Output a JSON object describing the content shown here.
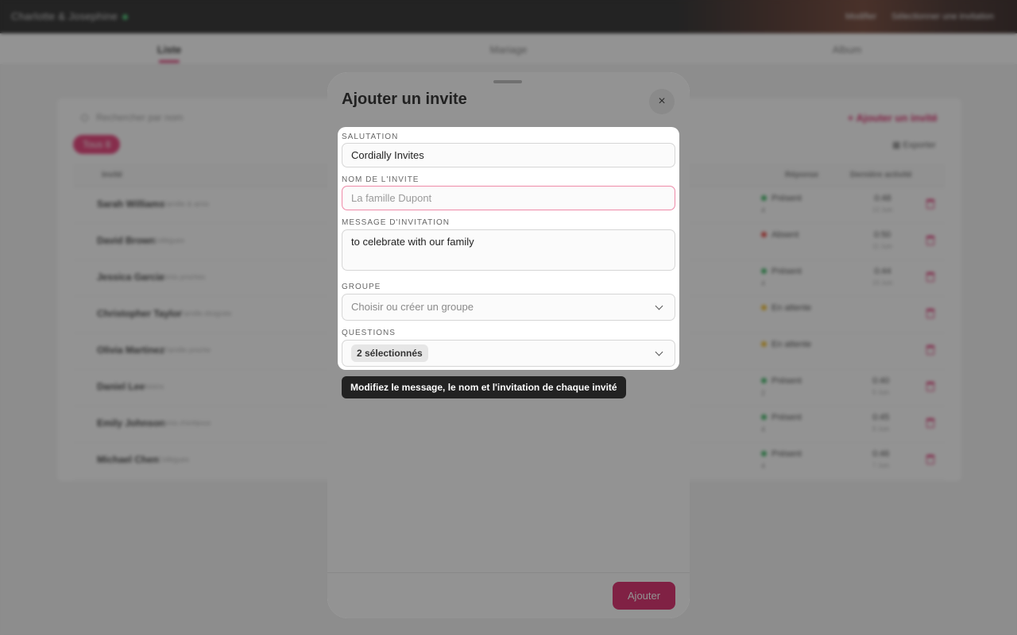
{
  "app": {
    "brand": "Charlotte & Josephine",
    "top_links": [
      "Modifier",
      "Sélectionner une invitation"
    ]
  },
  "tabs": [
    "Liste",
    "Mariage",
    "Album"
  ],
  "list": {
    "search_placeholder": "Rechercher par nom",
    "add_guest_label": "Ajouter un invité",
    "filter_chip": "Tous 8",
    "export_label": "Exporter",
    "columns": {
      "guest": "Invité",
      "response": "Réponse",
      "last_activity": "Dernière activité"
    },
    "rows": [
      {
        "name": "Sarah Williams",
        "sub": "Famille & amis",
        "status": "Présent",
        "count": "4",
        "time": "0:48",
        "date": "12 Juin"
      },
      {
        "name": "David Brown",
        "sub": "Collègues",
        "status": "Absent",
        "count": "",
        "time": "0:50",
        "date": "11 Juin"
      },
      {
        "name": "Jessica Garcia",
        "sub": "Amis proches",
        "status": "Présent",
        "count": "4",
        "time": "0:44",
        "date": "10 Juin"
      },
      {
        "name": "Christopher Taylor",
        "sub": "Famille éloignée",
        "status": "En attente",
        "count": "",
        "time": "",
        "date": ""
      },
      {
        "name": "Olivia Martinez",
        "sub": "Famille proche",
        "status": "En attente",
        "count": "",
        "time": "",
        "date": ""
      },
      {
        "name": "Daniel Lee",
        "sub": "Voisins",
        "status": "Présent",
        "count": "2",
        "time": "0:40",
        "date": "9 Juin"
      },
      {
        "name": "Emily Johnson",
        "sub": "Amis d'enfance",
        "status": "Présent",
        "count": "4",
        "time": "0:45",
        "date": "8 Juin"
      },
      {
        "name": "Michael Chen",
        "sub": "Collègues",
        "status": "Présent",
        "count": "4",
        "time": "0:46",
        "date": "7 Juin"
      }
    ]
  },
  "modal": {
    "title": "Ajouter un invite",
    "close_glyph": "×",
    "salutation_label": "SALUTATION",
    "salutation_value": "Cordially Invites",
    "name_label": "NOM DE L'INVITE",
    "name_placeholder": "La famille Dupont",
    "message_label": "MESSAGE D'INVITATION",
    "message_value": "to celebrate with our family",
    "group_label": "GROUPE",
    "group_placeholder": "Choisir ou créer un groupe",
    "questions_label": "QUESTIONS",
    "questions_value": "2 sélectionnés",
    "tooltip": "Modifiez le message, le nom et l'invitation de chaque invité",
    "submit_label": "Ajouter"
  },
  "colors": {
    "accent": "#d81b60",
    "present": "#2fb15a",
    "absent": "#e53935",
    "pending": "#f1b81c"
  }
}
